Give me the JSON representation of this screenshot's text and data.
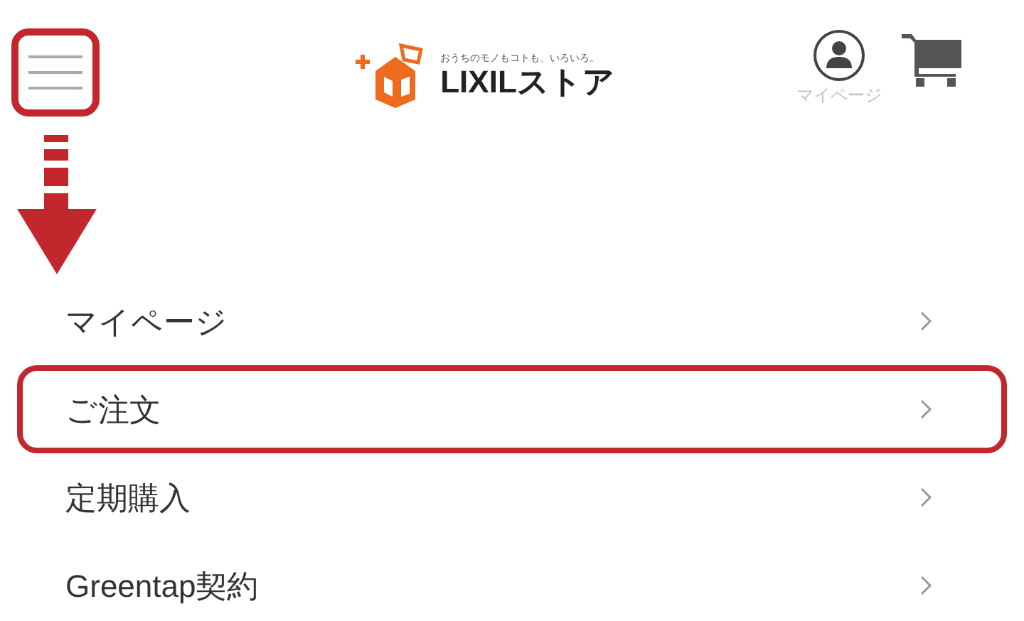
{
  "header": {
    "menu_button": {
      "highlighted": true
    },
    "logo": {
      "tagline": "おうちのモノもコトも、いろいろ。",
      "name": "LIXILストア"
    },
    "mypage": {
      "label": "マイページ"
    }
  },
  "menu": [
    {
      "label": "マイページ",
      "highlighted": false
    },
    {
      "label": "ご注文",
      "highlighted": true
    },
    {
      "label": "定期購入",
      "highlighted": false
    },
    {
      "label": "Greentap契約",
      "highlighted": false
    }
  ]
}
